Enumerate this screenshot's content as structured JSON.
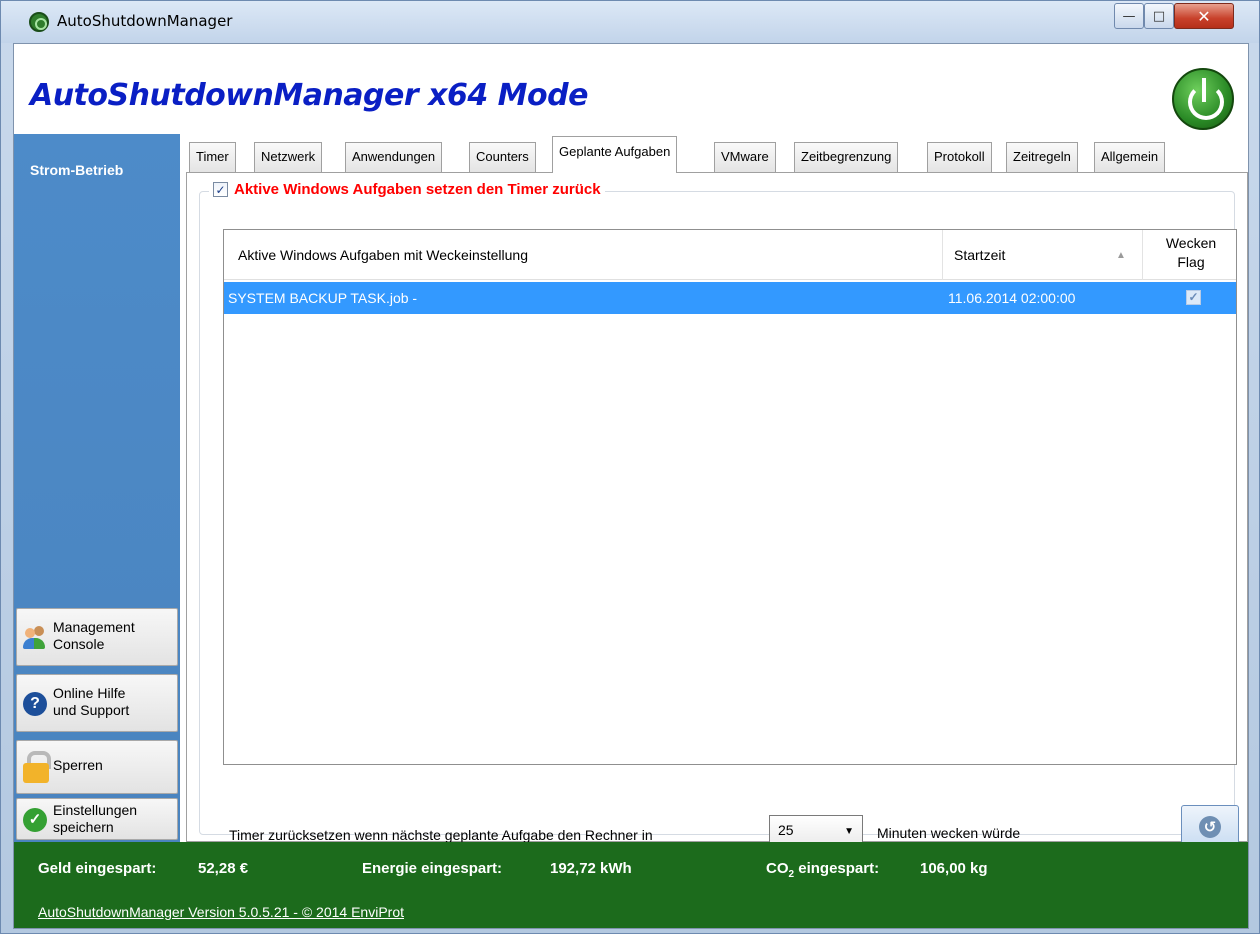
{
  "window": {
    "title": "AutoShutdownManager",
    "minimize_glyph": "—",
    "maximize_glyph": "□",
    "close_glyph": "✕"
  },
  "header": {
    "app_title": "AutoShutdownManager x64 Mode"
  },
  "sidebar": {
    "mode_label": "Strom-Betrieb",
    "buttons": [
      {
        "label_line1": "Management",
        "label_line2": "Console",
        "icon": "users-icon"
      },
      {
        "label_line1": "Online Hilfe",
        "label_line2": "und Support",
        "icon": "help-icon"
      },
      {
        "label_line1": "Sperren",
        "label_line2": "",
        "icon": "lock-icon"
      },
      {
        "label_line1": "Einstellungen",
        "label_line2": "speichern",
        "icon": "check-icon"
      }
    ]
  },
  "tabs": [
    "Timer",
    "Netzwerk",
    "Anwendungen",
    "Counters",
    "Geplante Aufgaben",
    "VMware",
    "Zeitbegrenzung",
    "Protokoll",
    "Zeitregeln",
    "Allgemein"
  ],
  "active_tab": "Geplante Aufgaben",
  "group": {
    "checkbox_checked": true,
    "checkbox_glyph": "✓",
    "legend": "Aktive Windows Aufgaben setzen den Timer zurück"
  },
  "table": {
    "columns": {
      "task": "Aktive Windows Aufgaben mit Weckeinstellung",
      "start": "Startzeit",
      "flag_line1": "Wecken",
      "flag_line2": "Flag"
    },
    "sort_glyph": "▲",
    "rows": [
      {
        "task": "SYSTEM BACKUP TASK.job -",
        "start": "11.06.2014 02:00:00",
        "flag": true,
        "flag_glyph": "✓"
      }
    ]
  },
  "bottom": {
    "label_before": "Timer zurücksetzen wenn nächste geplante Aufgabe den Rechner in",
    "minutes_value": "25",
    "dropdown_glyph": "▼",
    "label_after": "Minuten wecken würde",
    "refresh_glyph": "↺"
  },
  "footer": {
    "money_label": "Geld eingespart:",
    "money_value": "52,28 €",
    "energy_label": "Energie eingespart:",
    "energy_value": "192,72 kWh",
    "co2_label_prefix": "CO",
    "co2_label_sub": "2",
    "co2_label_suffix": " eingespart:",
    "co2_value": "106,00 kg",
    "version_text": "AutoShutdownManager Version 5.0.5.21  - © 2014 EnviProt"
  },
  "colors": {
    "title_blue": "#0a1fc4",
    "sidebar_blue": "#4d8bc9",
    "selection_blue": "#3399ff",
    "legend_red": "#ff0000",
    "footer_green": "#1c6b1c"
  }
}
